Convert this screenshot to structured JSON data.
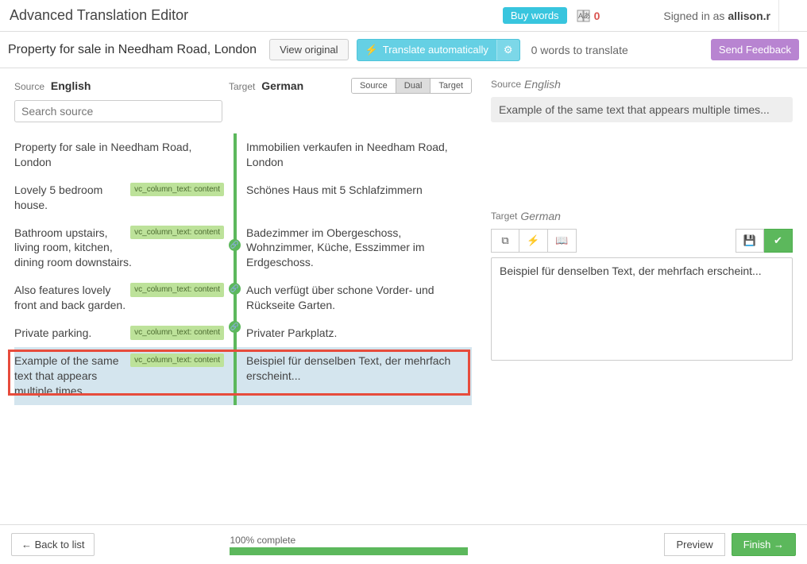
{
  "header": {
    "title": "Advanced Translation Editor",
    "buy_words": "Buy words",
    "word_balance": "0",
    "signed_in_prefix": "Signed in as ",
    "username": "allison.r"
  },
  "subheader": {
    "job_title": "Property for sale in Needham Road, London",
    "view_original": "View original",
    "translate_auto": "Translate automatically",
    "words_to_translate": "0 words to translate",
    "send_feedback": "Send Feedback"
  },
  "languages": {
    "source_label": "Source",
    "source_lang": "English",
    "target_label": "Target",
    "target_lang": "German"
  },
  "view_toggle": {
    "source": "Source",
    "dual": "Dual",
    "target": "Target"
  },
  "search": {
    "placeholder": "Search source"
  },
  "segments": [
    {
      "source": "Property for sale in Needham Road, London",
      "target": "Immobilien verkaufen in Needham Road, London",
      "tag": ""
    },
    {
      "source": "Lovely 5 bedroom house.",
      "target": "Schönes Haus mit 5 Schlafzimmern",
      "tag": "vc_column_text: content"
    },
    {
      "source": "Bathroom upstairs, living room, kitchen, dining room downstairs.",
      "target": "Badezimmer im Obergeschoss, Wohnzimmer, Küche, Esszimmer im Erdgeschoss.",
      "tag": "vc_column_text: content"
    },
    {
      "source": "Also features lovely front and back garden.",
      "target": "Auch verfügt über schone Vorder- und Rückseite Garten.",
      "tag": "vc_column_text: content"
    },
    {
      "source": "Private parking.",
      "target": "Privater Parkplatz.",
      "tag": "vc_column_text: content"
    },
    {
      "source": "Example of the same text that appears multiple times...",
      "target": "Beispiel für denselben Text, der mehrfach erscheint...",
      "tag": "vc_column_text: content"
    }
  ],
  "detail": {
    "source_text": "Example of the same text that appears multiple times...",
    "target_text": "Beispiel für denselben Text, der mehrfach erscheint..."
  },
  "footer": {
    "back": "← Back to list",
    "progress_label": "100% complete",
    "preview": "Preview",
    "finish": "Finish →"
  }
}
